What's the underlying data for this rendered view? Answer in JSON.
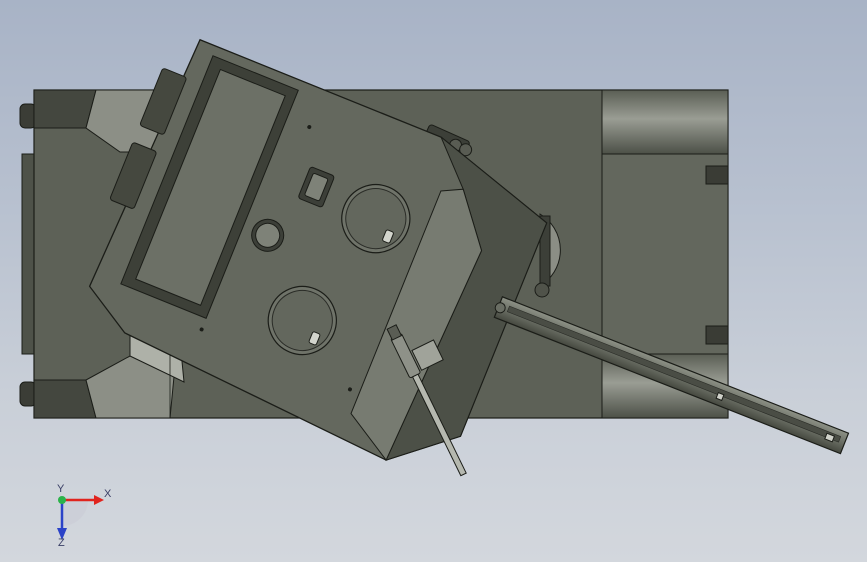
{
  "viewport": {
    "model": "tank-top-view",
    "colors": {
      "background_top": "#a8b3c6",
      "background_bottom": "#d3d7dd",
      "hull_dark": "#3f4239",
      "hull_mid": "#5b5f55",
      "hull_light": "#7c8177",
      "turret_top": "#64685e",
      "turret_edge": "#8a8e84",
      "outline": "#1b1d18"
    }
  },
  "triad": {
    "x_label": "X",
    "y_label": "Y",
    "z_label": "Z",
    "x_color": "#e0241e",
    "y_color": "#2bb34a",
    "z_color": "#2b43c8"
  }
}
